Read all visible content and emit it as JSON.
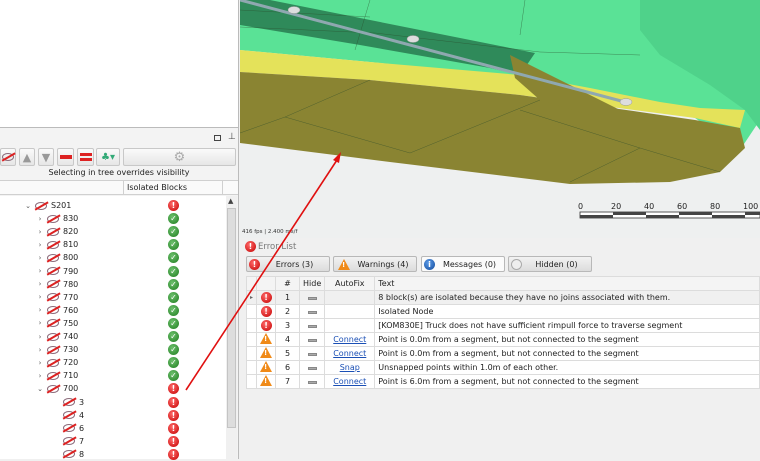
{
  "tree_panel": {
    "hint": "Selecting in tree overrides visibility",
    "column_header": "Isolated Blocks",
    "items": [
      {
        "label": "S201",
        "level": 0,
        "expanded": true,
        "status": "error"
      },
      {
        "label": "830",
        "level": 1,
        "status": "ok"
      },
      {
        "label": "820",
        "level": 1,
        "status": "ok"
      },
      {
        "label": "810",
        "level": 1,
        "status": "ok"
      },
      {
        "label": "800",
        "level": 1,
        "status": "ok"
      },
      {
        "label": "790",
        "level": 1,
        "status": "ok"
      },
      {
        "label": "780",
        "level": 1,
        "status": "ok"
      },
      {
        "label": "770",
        "level": 1,
        "status": "ok"
      },
      {
        "label": "760",
        "level": 1,
        "status": "ok"
      },
      {
        "label": "750",
        "level": 1,
        "status": "ok"
      },
      {
        "label": "740",
        "level": 1,
        "status": "ok"
      },
      {
        "label": "730",
        "level": 1,
        "status": "ok"
      },
      {
        "label": "720",
        "level": 1,
        "status": "ok"
      },
      {
        "label": "710",
        "level": 1,
        "status": "ok"
      },
      {
        "label": "700",
        "level": 1,
        "expanded": true,
        "status": "error"
      },
      {
        "label": "3",
        "level": 2,
        "status": "error"
      },
      {
        "label": "4",
        "level": 2,
        "status": "error"
      },
      {
        "label": "6",
        "level": 2,
        "status": "error"
      },
      {
        "label": "7",
        "level": 2,
        "status": "error"
      },
      {
        "label": "8",
        "level": 2,
        "status": "error"
      }
    ]
  },
  "viewport": {
    "fps": "416 fps | 2.400 ms/f",
    "scale_labels": [
      "0",
      "20",
      "40",
      "60",
      "80",
      "100"
    ]
  },
  "error_list": {
    "title": "Error List",
    "filters": {
      "errors": "Errors (3)",
      "warnings": "Warnings (4)",
      "messages": "Messages (0)",
      "hidden": "Hidden (0)"
    },
    "columns": [
      "#",
      "Hide",
      "AutoFix",
      "Text"
    ],
    "rows": [
      {
        "type": "error",
        "num": "1",
        "autofix": "",
        "text": "8 block(s) are isolated because they have no joins associated with them."
      },
      {
        "type": "error",
        "num": "2",
        "autofix": "",
        "text": "Isolated Node"
      },
      {
        "type": "error",
        "num": "3",
        "autofix": "",
        "text": "[KOM830E] Truck does not have sufficient rimpull force to traverse segment"
      },
      {
        "type": "warning",
        "num": "4",
        "autofix": "Connect",
        "text": "Point is 0.0m from a segment, but not connected to the segment"
      },
      {
        "type": "warning",
        "num": "5",
        "autofix": "Connect",
        "text": "Point is 0.0m from a segment, but not connected to the segment"
      },
      {
        "type": "warning",
        "num": "6",
        "autofix": "Snap",
        "text": "Unsnapped points within 1.0m of each other."
      },
      {
        "type": "warning",
        "num": "7",
        "autofix": "Connect",
        "text": "Point is 6.0m from a segment, but not connected to the segment"
      }
    ]
  },
  "colors": {
    "annotation_arrow": "#e01010",
    "green": "#5ae296",
    "yellow": "#e4e25a",
    "olive": "#8a8432"
  }
}
